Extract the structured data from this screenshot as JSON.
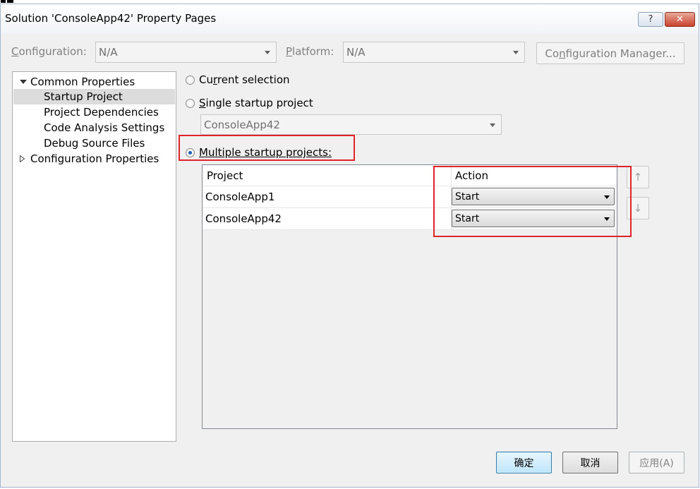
{
  "window": {
    "title": "Solution 'ConsoleApp42' Property Pages",
    "help_label": "?",
    "close_label": "✕"
  },
  "config_bar": {
    "configuration_label_pre": "",
    "configuration_label_hotkey": "C",
    "configuration_label_post": "onfiguration:",
    "configuration_value": "N/A",
    "platform_label_hotkey": "P",
    "platform_label_post": "latform:",
    "platform_value": "N/A",
    "manager_pre": "Co",
    "manager_hotkey": "n",
    "manager_post": "figuration Manager..."
  },
  "tree": {
    "items": [
      {
        "label": "Common Properties",
        "expander": "expanded"
      },
      {
        "label": "Startup Project",
        "selected": true
      },
      {
        "label": "Project Dependencies"
      },
      {
        "label": "Code Analysis Settings"
      },
      {
        "label": "Debug Source Files"
      },
      {
        "label": "Configuration Properties",
        "expander": "collapsed"
      }
    ]
  },
  "startup": {
    "current_selection": {
      "pre": "Cu",
      "hotkey": "r",
      "post": "rent selection",
      "checked": false
    },
    "single_startup": {
      "pre": "",
      "hotkey": "S",
      "post": "ingle startup project",
      "checked": false
    },
    "single_project_value": "ConsoleApp42",
    "multiple_startup": {
      "pre": "",
      "hotkey": "M",
      "post": "ultiple startup projects:",
      "checked": true
    }
  },
  "grid": {
    "headers": {
      "project": "Project",
      "action": "Action"
    },
    "rows": [
      {
        "project": "ConsoleApp1",
        "action": "Start"
      },
      {
        "project": "ConsoleApp42",
        "action": "Start"
      }
    ],
    "move_up_icon": "↑",
    "move_down_icon": "↓"
  },
  "buttons": {
    "ok": "确定",
    "cancel": "取消",
    "apply": "应用(A)"
  },
  "colors": {
    "highlight_red": "#e0242c",
    "radio_dot": "#1b5fb5"
  }
}
